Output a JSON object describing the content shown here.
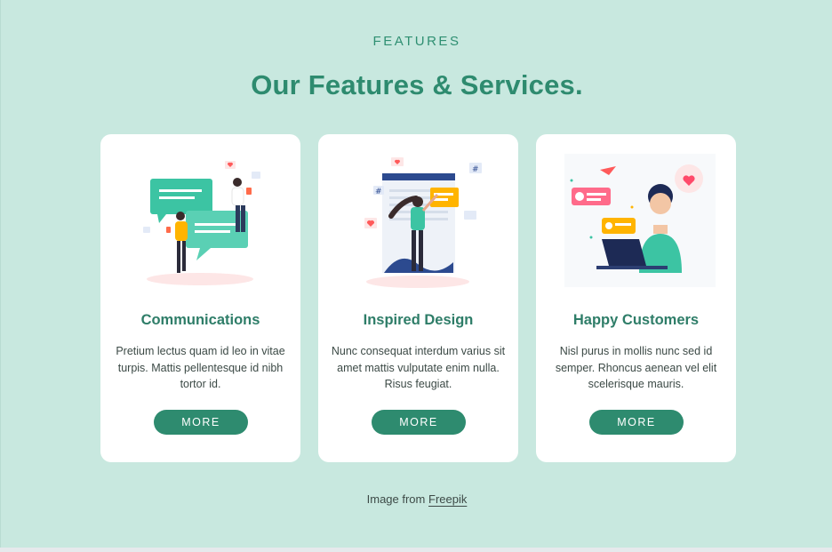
{
  "section": {
    "eyebrow": "FEATURES",
    "title": "Our Features & Services."
  },
  "cards": [
    {
      "title": "Communications",
      "text": "Pretium lectus quam id leo in vitae turpis. Mattis pellentesque id nibh tortor id.",
      "button": "MORE",
      "illustration": "chat-bubbles-people-illustration"
    },
    {
      "title": "Inspired Design",
      "text": "Nunc consequat interdum varius sit amet mattis vulputate enim nulla. Risus feugiat.",
      "button": "MORE",
      "illustration": "woman-web-design-illustration"
    },
    {
      "title": "Happy Customers",
      "text": "Nisl purus in mollis nunc sed id semper. Rhoncus aenean vel elit scelerisque mauris.",
      "button": "MORE",
      "illustration": "man-laptop-messages-illustration"
    }
  ],
  "credit": {
    "prefix": "Image from",
    "link": "Freepik"
  },
  "colors": {
    "background": "#c8e8df",
    "accent": "#2e8b6f",
    "card": "#ffffff"
  }
}
